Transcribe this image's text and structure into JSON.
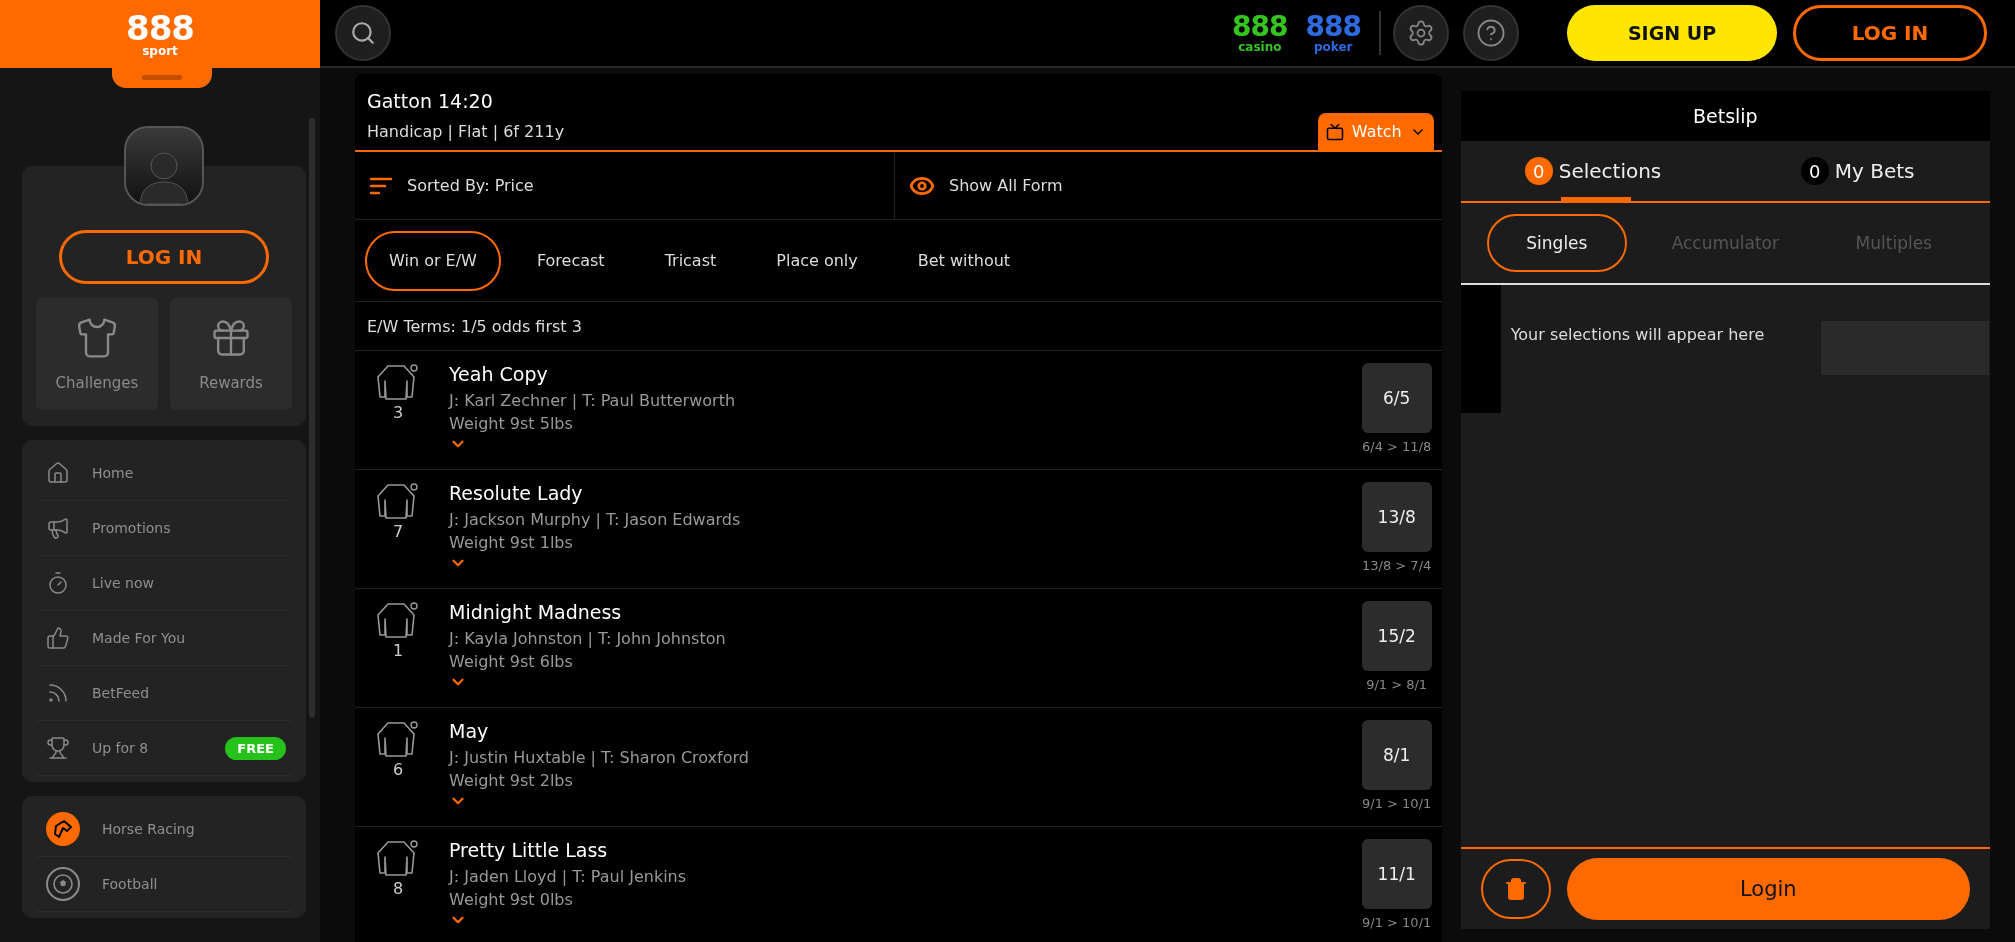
{
  "brand": {
    "logo": "888",
    "sub": "sport"
  },
  "header": {
    "sister_sites": [
      {
        "logo": "888",
        "label": "casino",
        "color": "#35c51f"
      },
      {
        "logo": "888",
        "label": "poker",
        "color": "#2e6be0"
      }
    ],
    "signup": "SIGN UP",
    "login": "LOG IN"
  },
  "profile": {
    "login": "LOG IN",
    "tiles": [
      {
        "label": "Challenges",
        "kind": "shirt"
      },
      {
        "label": "Rewards",
        "kind": "gift"
      }
    ]
  },
  "menu": [
    {
      "label": "Home",
      "kind": "home"
    },
    {
      "label": "Promotions",
      "kind": "megaphone"
    },
    {
      "label": "Live now",
      "kind": "timer"
    },
    {
      "label": "Made For You",
      "kind": "thumb"
    },
    {
      "label": "BetFeed",
      "kind": "rss"
    },
    {
      "label": "Up for 8",
      "kind": "trophy",
      "badge": "FREE"
    }
  ],
  "sports": [
    {
      "label": "Horse Racing",
      "kind": "horse",
      "selected": true
    },
    {
      "label": "Football",
      "kind": "ball",
      "selected": false
    }
  ],
  "race": {
    "title": "Gatton 14:20",
    "subtitle": "Handicap | Flat | 6f 211y",
    "watch": "Watch",
    "sort": "Sorted By: Price",
    "form": "Show All Form",
    "markets": [
      {
        "label": "Win or E/W",
        "selected": true
      },
      {
        "label": "Forecast",
        "selected": false
      },
      {
        "label": "Tricast",
        "selected": false
      },
      {
        "label": "Place only",
        "selected": false
      },
      {
        "label": "Bet without",
        "selected": false
      }
    ],
    "terms": "E/W Terms: 1/5 odds first 3",
    "runners": [
      {
        "name": "Yeah Copy",
        "number": "3",
        "people": "J: Karl Zechner | T: Paul Butterworth",
        "weight": "Weight 9st 5lbs",
        "price": "6/5",
        "history": "6/4 > 11/8"
      },
      {
        "name": "Resolute Lady",
        "number": "7",
        "people": "J: Jackson Murphy | T: Jason Edwards",
        "weight": "Weight 9st 1lbs",
        "price": "13/8",
        "history": "13/8 > 7/4"
      },
      {
        "name": "Midnight Madness",
        "number": "1",
        "people": "J: Kayla Johnston | T: John Johnston",
        "weight": "Weight 9st 6lbs",
        "price": "15/2",
        "history": "9/1 > 8/1"
      },
      {
        "name": "May",
        "number": "6",
        "people": "J: Justin Huxtable | T: Sharon Croxford",
        "weight": "Weight 9st 2lbs",
        "price": "8/1",
        "history": "9/1 > 10/1"
      },
      {
        "name": "Pretty Little Lass",
        "number": "8",
        "people": "J: Jaden Lloyd | T: Paul Jenkins",
        "weight": "Weight 9st 0lbs",
        "price": "11/1",
        "history": "9/1 > 10/1"
      }
    ]
  },
  "betslip": {
    "title": "Betslip",
    "tabs": [
      {
        "count": "0",
        "label": "Selections",
        "selected": true
      },
      {
        "count": "0",
        "label": "My Bets",
        "selected": false
      }
    ],
    "types": [
      {
        "label": "Singles",
        "selected": true
      },
      {
        "label": "Accumulator",
        "selected": false
      },
      {
        "label": "Multiples",
        "selected": false
      }
    ],
    "empty": "Your selections will appear here",
    "login": "Login"
  }
}
